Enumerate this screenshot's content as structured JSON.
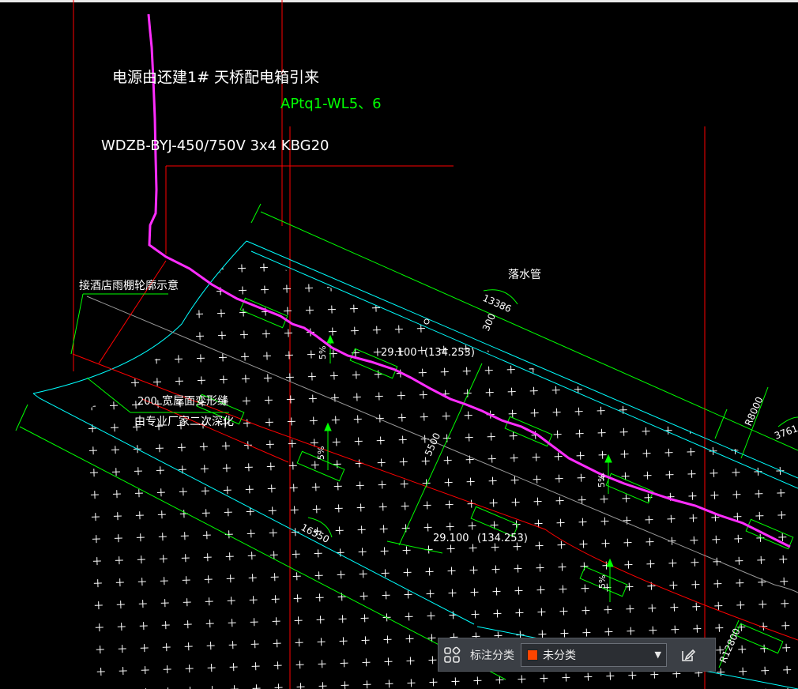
{
  "drawing": {
    "colors": {
      "background": "#000000",
      "annotation_white": "#ffffff",
      "dimension_green": "#00ff00",
      "red_line": "#ff0000",
      "cyan_line": "#00ffff",
      "gray_line": "#a0a0a0",
      "cable_magenta": "#ff2dff"
    },
    "texts": {
      "power_source": "电源由还建1# 天桥配电箱引来",
      "circuit_id": "APtq1-WL5、6",
      "cable_spec": "WDZB-BYJ-450/750V 3x4  KBG20",
      "canopy_note": "接酒店雨棚轮廓示意",
      "joint_width": "200",
      "joint_name": "宽屋面变形缝",
      "joint_note": "由专业厂家二次深化",
      "downpipe": "落水管",
      "dim_13386": "13386",
      "dim_300": "300",
      "level_1": "29.100",
      "level_1_paren": "(134.253)",
      "level_2": "29.100",
      "level_2_paren": "(134.253)",
      "dim_5500": "5500",
      "dim_16550": "16550",
      "radius_r8000": "R8000",
      "radius_r12800": "R12800",
      "dim_3761": "3761",
      "slope_1": "5%",
      "slope_2": "5%",
      "slope_3": "5%",
      "slope_4": "5%"
    }
  },
  "toolbar": {
    "category_label": "标注分类",
    "selected_category": "未分类",
    "selected_color": "#ff4500",
    "layout_icon": "grid-layout-icon",
    "dropdown_icon": "chevron-down-icon",
    "edit_icon": "edit-icon"
  }
}
